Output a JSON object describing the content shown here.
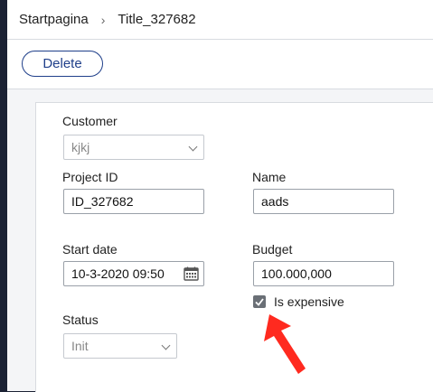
{
  "breadcrumb": {
    "home": "Startpagina",
    "separator": "›",
    "current": "Title_327682"
  },
  "toolbar": {
    "delete_label": "Delete"
  },
  "form": {
    "customer": {
      "label": "Customer",
      "value": "kjkj"
    },
    "project_id": {
      "label": "Project ID",
      "value": "ID_327682"
    },
    "name": {
      "label": "Name",
      "value": "aads"
    },
    "start_date": {
      "label": "Start date",
      "value": "10-3-2020 09:50"
    },
    "budget": {
      "label": "Budget",
      "value": "100.000,000"
    },
    "is_expensive": {
      "label": "Is expensive",
      "checked": true
    },
    "status": {
      "label": "Status",
      "value": "Init"
    }
  },
  "colors": {
    "accent": "#1f3f8a",
    "annotation_arrow": "#ff2a1f"
  }
}
